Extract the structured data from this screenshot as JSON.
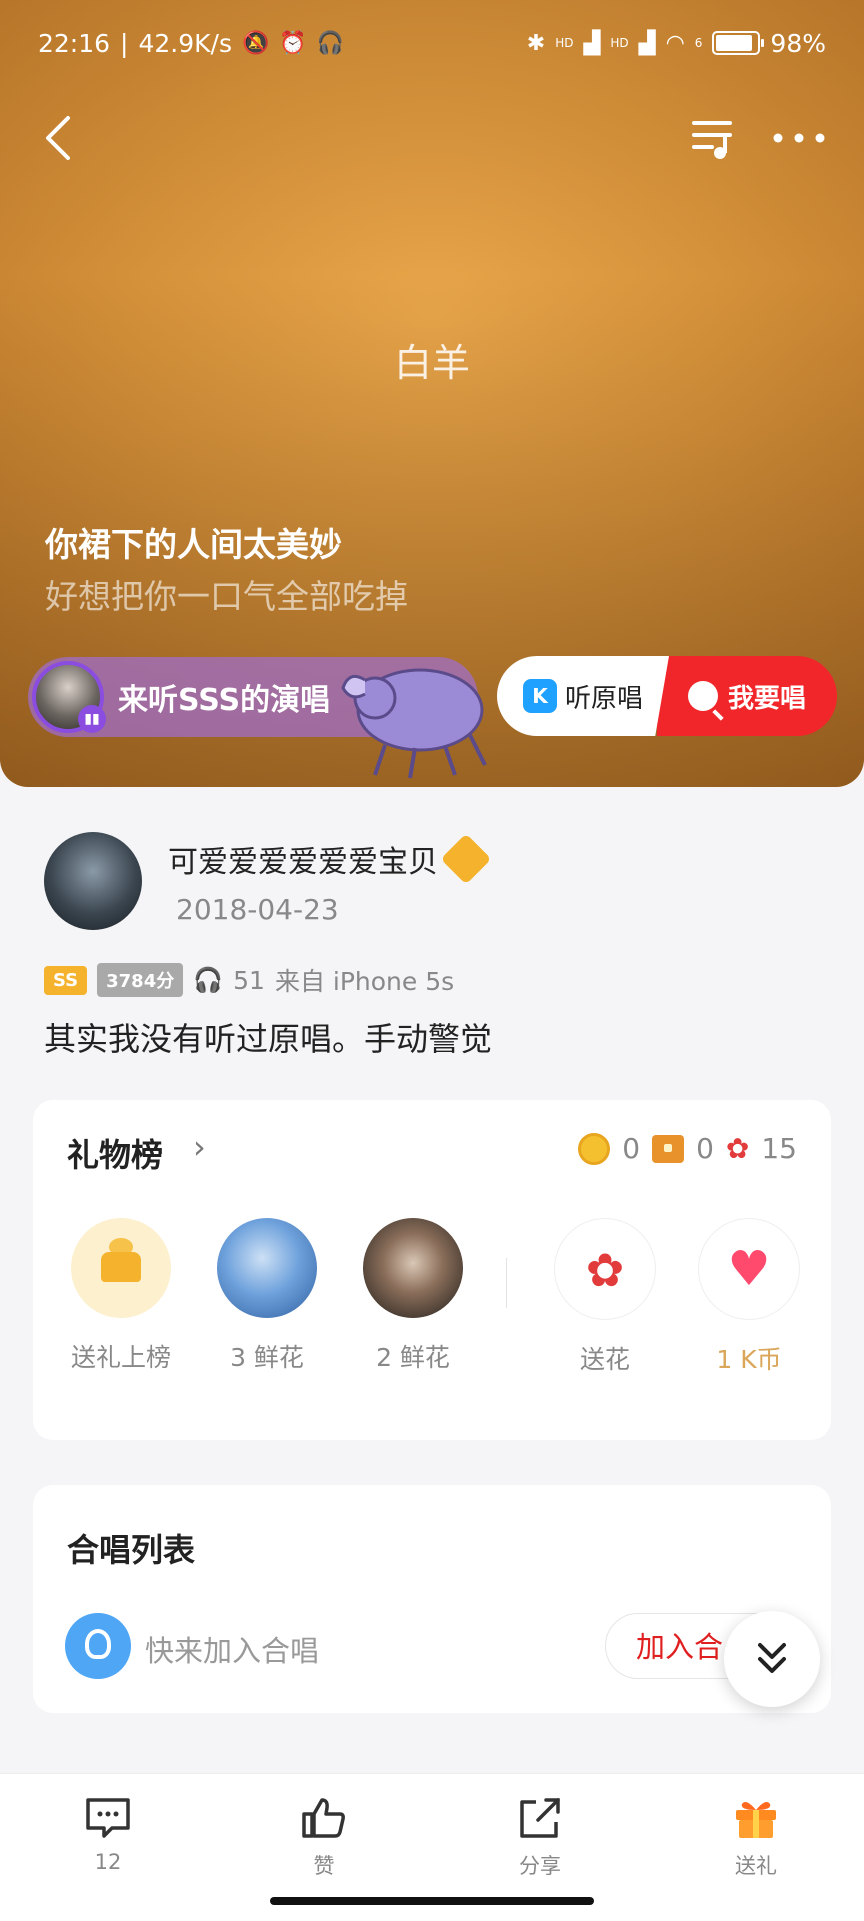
{
  "status_bar": {
    "time": "22:16",
    "net_speed": "42.9K/s",
    "signal_label_1": "HD",
    "signal_label_2": "HD",
    "wifi_badge": "6",
    "battery": "98%"
  },
  "hero": {
    "song_title": "白羊",
    "lyric_current": "你裙下的人间太美妙",
    "lyric_next": "好想把你一口气全部吃掉",
    "listen_pill_text": "来听SSS的演唱",
    "listen_close": "✕",
    "original_label": "听原唱",
    "original_icon_letter": "K",
    "sing_label": "我要唱"
  },
  "user": {
    "name": "可爱爱爱爱爱爱宝贝",
    "date": "2018-04-23",
    "level_tag": "SS",
    "score_tag": "3784分",
    "listen_count": "51",
    "device": "来自 iPhone 5s",
    "caption": "其实我没有听过原唱。手动警觉"
  },
  "gift_board": {
    "title": "礼物榜",
    "coins": "0",
    "chests": "0",
    "flowers": "15",
    "items": [
      {
        "label": "送礼上榜"
      },
      {
        "label": "3 鲜花"
      },
      {
        "label": "2 鲜花"
      },
      {
        "label": "送花"
      },
      {
        "label": "1 K币"
      }
    ]
  },
  "chorus": {
    "title": "合唱列表",
    "hint": "快来加入合唱",
    "join_label": "加入合"
  },
  "bottom_nav": [
    {
      "label": "12",
      "icon": "comment-icon"
    },
    {
      "label": "赞",
      "icon": "like-icon"
    },
    {
      "label": "分享",
      "icon": "share-icon"
    },
    {
      "label": "送礼",
      "icon": "gift-icon"
    }
  ],
  "colors": {
    "accent_red": "#f1262a",
    "gold": "#f5b22c",
    "hero_orange": "#d6923a"
  }
}
